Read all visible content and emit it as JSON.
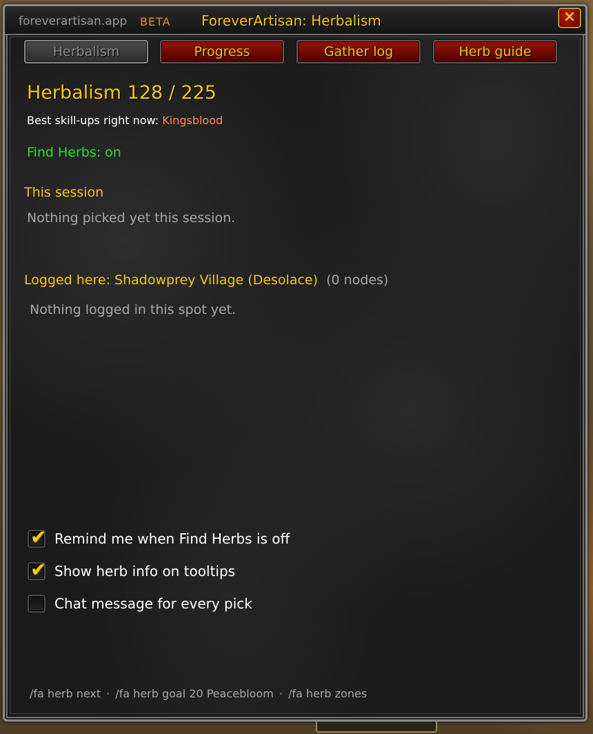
{
  "header": {
    "brand": "foreverartisan.app",
    "badge": "BETA",
    "title": "ForeverArtisan: Herbalism",
    "close_glyph": "✕"
  },
  "tabs": [
    {
      "label": "Herbalism",
      "active": true
    },
    {
      "label": "Progress",
      "active": false
    },
    {
      "label": "Gather log",
      "active": false
    },
    {
      "label": "Herb guide",
      "active": false
    }
  ],
  "skill": {
    "title": "Herbalism 128 / 225",
    "best_label": "Best skill-ups right now:",
    "best_herb": "Kingsblood",
    "find_herbs": "Find Herbs: on"
  },
  "session": {
    "heading": "This session",
    "empty": "Nothing picked yet this session."
  },
  "location": {
    "heading": "Logged here: Shadowprey Village (Desolace)",
    "count": "(0 nodes)",
    "empty": "Nothing logged in this spot yet."
  },
  "options": [
    {
      "label": "Remind me when Find Herbs is off",
      "checked": true
    },
    {
      "label": "Show herb info on tooltips",
      "checked": true
    },
    {
      "label": "Chat message for every pick",
      "checked": false
    }
  ],
  "footer": {
    "cmd1": "/fa herb next",
    "cmd2": "/fa herb goal 20 Peacebloom",
    "cmd3": "/fa herb zones",
    "separator": "·"
  },
  "colors": {
    "gold": "#f4c518",
    "green": "#2be02b",
    "orange": "#ff8a50",
    "gray": "#a8a8a8"
  }
}
